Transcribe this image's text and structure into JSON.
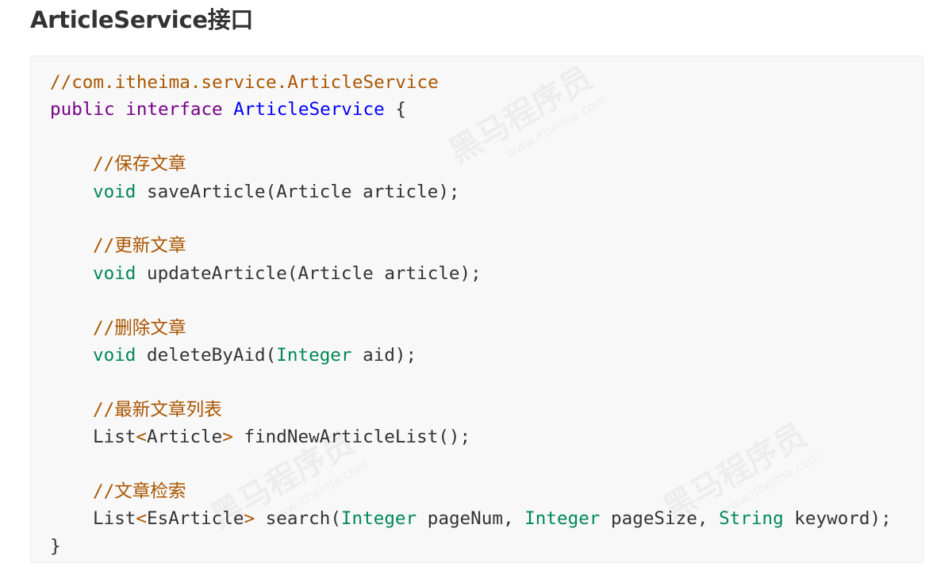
{
  "heading": "ArticleService接口",
  "code": {
    "package_comment": "//com.itheima.service.ArticleService",
    "decl": {
      "public": "public",
      "interface": "interface",
      "name": "ArticleService",
      "open": "{"
    },
    "methods": [
      {
        "comment": "//保存文章",
        "ret": "void",
        "name": "saveArticle",
        "open": "(",
        "params": [
          {
            "type": "Article",
            "name": "article",
            "highlight": false
          }
        ],
        "close": ");"
      },
      {
        "comment": "//更新文章",
        "ret": "void",
        "name": "updateArticle",
        "open": "(",
        "params": [
          {
            "type": "Article",
            "name": "article",
            "highlight": false
          }
        ],
        "close": ");"
      },
      {
        "comment": "//删除文章",
        "ret": "void",
        "name": "deleteByAid",
        "open": "(",
        "params": [
          {
            "type": "Integer",
            "name": "aid",
            "highlight": true
          }
        ],
        "close": ");"
      },
      {
        "comment": "//最新文章列表",
        "ret": "List",
        "generic": "Article",
        "name": "findNewArticleList",
        "call": "();"
      },
      {
        "comment": "//文章检索",
        "ret": "List",
        "generic": "EsArticle",
        "name": "search",
        "open": "(",
        "params": [
          {
            "type": "Integer",
            "name": "pageNum",
            "highlight": true
          },
          {
            "type": "Integer",
            "name": "pageSize",
            "highlight": true
          },
          {
            "type": "String",
            "name": "keyword",
            "highlight": true
          }
        ],
        "close": ");"
      }
    ],
    "close_brace": "}"
  },
  "watermark": {
    "text": "黑马程序员",
    "url": "www.itheima.com"
  },
  "colors": {
    "comment": "#aa5500",
    "keyword": "#770088",
    "def": "#0000ff",
    "type": "#008855",
    "code_bg": "#f8f8f8",
    "heading": "#333333"
  }
}
